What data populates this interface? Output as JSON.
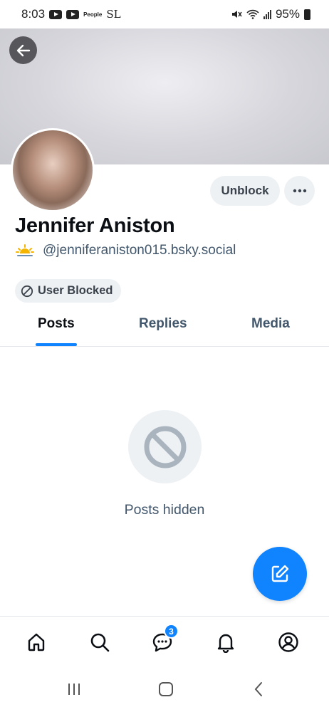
{
  "status_bar": {
    "time": "8:03",
    "people_label": "People",
    "sl_label": "SL",
    "battery": "95%"
  },
  "profile": {
    "display_name": "Jennifer Aniston",
    "handle": "@jenniferaniston015.bsky.social",
    "unblock_label": "Unblock",
    "blocked_label": "User Blocked"
  },
  "tabs": [
    {
      "label": "Posts",
      "active": true
    },
    {
      "label": "Replies",
      "active": false
    },
    {
      "label": "Media",
      "active": false
    }
  ],
  "empty_state": {
    "message": "Posts hidden"
  },
  "bottom_nav": {
    "chat_badge": "3",
    "items": [
      "home-icon",
      "search-icon",
      "chat-icon",
      "bell-icon",
      "profile-icon"
    ]
  },
  "colors": {
    "accent": "#1083fe",
    "muted_text": "#42576c",
    "chip_bg": "#eef1f4"
  }
}
